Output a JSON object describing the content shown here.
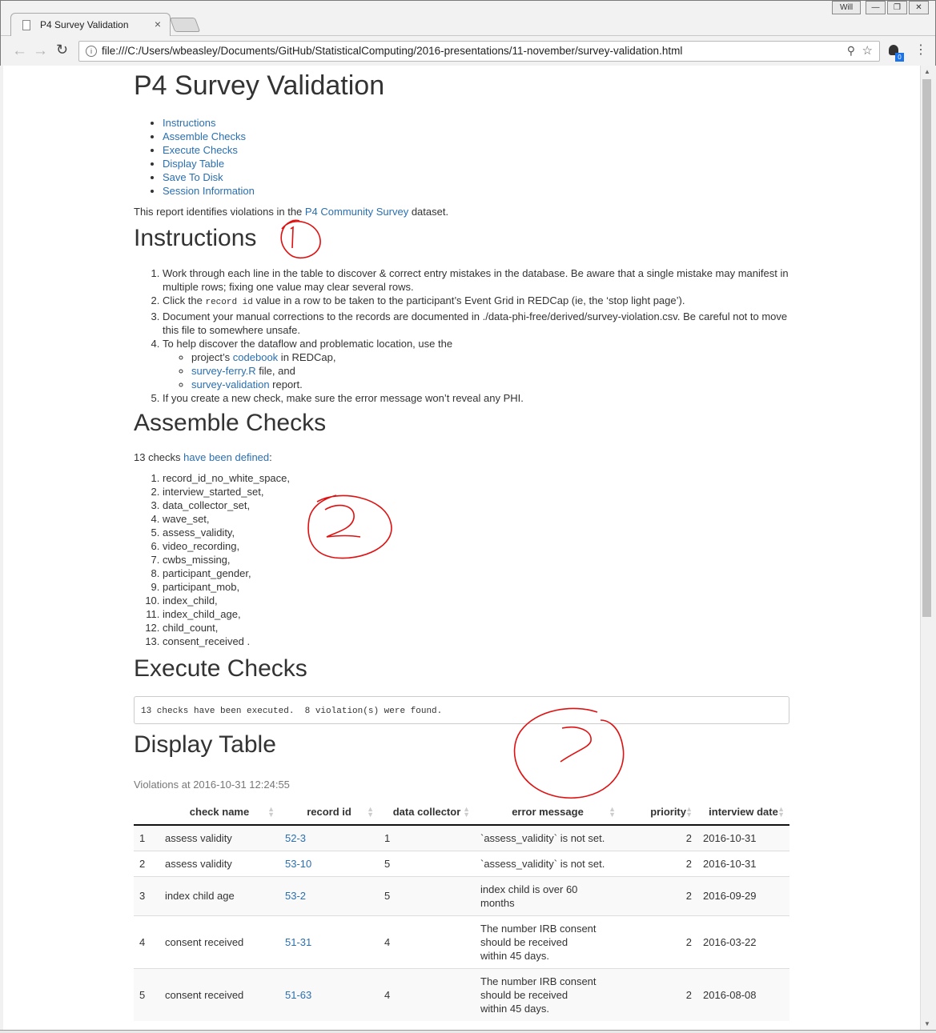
{
  "browser": {
    "tab_title": "P4 Survey Validation",
    "tab_close": "×",
    "user_label": "Will",
    "url": "file:///C:/Users/wbeasley/Documents/GitHub/StatisticalComputing/2016-presentations/11-november/survey-validation.html",
    "ext_badge": "0"
  },
  "page": {
    "title": "P4 Survey Validation",
    "toc": [
      "Instructions",
      "Assemble Checks",
      "Execute Checks",
      "Display Table",
      "Save To Disk",
      "Session Information"
    ],
    "intro_pre": "This report identifies violations in the ",
    "intro_link": "P4 Community Survey",
    "intro_post": " dataset.",
    "instructions_heading": "Instructions",
    "instructions": {
      "i1": "Work through each line in the table to discover & correct entry mistakes in the database. Be aware that a single mistake may manifest in multiple rows; fixing one value may clear several rows.",
      "i2_pre": "Click the ",
      "i2_code": "record id",
      "i2_post": " value in a row to be taken to the participant’s Event Grid in REDCap (ie, the ‘stop light page’).",
      "i3": "Document your manual corrections to the records are documented in ./data-phi-free/derived/survey-violation.csv. Be careful not to move this file to somewhere unsafe.",
      "i4": "To help discover the dataflow and problematic location, use the",
      "i4a_pre": "project’s ",
      "i4a_link": "codebook",
      "i4a_post": " in REDCap,",
      "i4b_link": "survey-ferry.R",
      "i4b_post": " file, and",
      "i4c_link": "survey-validation",
      "i4c_post": " report.",
      "i5": "If you create a new check, make sure the error message won’t reveal any PHI."
    },
    "assemble_heading": "Assemble Checks",
    "assemble_pre": "13 checks ",
    "assemble_link": "have been defined",
    "assemble_post": ":",
    "checks": [
      "record_id_no_white_space,",
      "interview_started_set,",
      "data_collector_set,",
      "wave_set,",
      "assess_validity,",
      "video_recording,",
      "cwbs_missing,",
      "participant_gender,",
      "participant_mob,",
      "index_child,",
      "index_child_age,",
      "child_count,",
      "consent_received ."
    ],
    "execute_heading": "Execute Checks",
    "execute_output": "13 checks have been executed.  8 violation(s) were found.",
    "display_heading": "Display Table",
    "table_caption": "Violations at 2016-10-31 12:24:55",
    "table": {
      "headers": [
        "check name",
        "record id",
        "data collector",
        "error message",
        "priority",
        "interview date"
      ],
      "rows": [
        {
          "n": "1",
          "check": "assess validity",
          "record": "52-3",
          "collector": "1",
          "msg": "`assess_validity` is not set.",
          "priority": "2",
          "date": "2016-10-31"
        },
        {
          "n": "2",
          "check": "assess validity",
          "record": "53-10",
          "collector": "5",
          "msg": "`assess_validity` is not set.",
          "priority": "2",
          "date": "2016-10-31"
        },
        {
          "n": "3",
          "check": "index child age",
          "record": "53-2",
          "collector": "5",
          "msg": "index child is over 60 months",
          "priority": "2",
          "date": "2016-09-29"
        },
        {
          "n": "4",
          "check": "consent received",
          "record": "51-31",
          "collector": "4",
          "msg": "The number IRB consent should be received within 45 days.",
          "priority": "2",
          "date": "2016-03-22"
        },
        {
          "n": "5",
          "check": "consent received",
          "record": "51-63",
          "collector": "4",
          "msg": "The number IRB consent should be received within 45 days.",
          "priority": "2",
          "date": "2016-08-08"
        }
      ]
    }
  },
  "colors": {
    "link": "#2a6fb0",
    "annotation": "#e01010"
  }
}
